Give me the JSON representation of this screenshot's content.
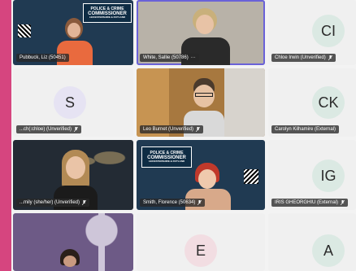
{
  "colors": {
    "accent": "#d6457f",
    "active_speaker": "#6a62d8",
    "avatar_purple": "#e6e3f3",
    "avatar_teal": "#dbe9e3",
    "avatar_pink": "#f2dde2"
  },
  "tiles": [
    {
      "name": "Pubbuck, Liz (50451)",
      "kind": "video"
    },
    {
      "name": "White, Sallie (50786)",
      "kind": "video",
      "extra": "···"
    },
    {
      "name": "Chloe Irwin (Unverified)",
      "kind": "avatar",
      "initials": "CI"
    },
    {
      "name": "...ch(:chloe) (Unverified)",
      "kind": "avatar",
      "initials": "S"
    },
    {
      "name": "Leo Burnet (Unverified)",
      "kind": "video"
    },
    {
      "name": "Carolyn Kilhamire (External)",
      "kind": "avatar",
      "initials": "CK"
    },
    {
      "name": "...mily (she/her) (Unverified)",
      "kind": "video"
    },
    {
      "name": "Smith, Florence (50634)",
      "kind": "video"
    },
    {
      "name": "IRIS GHEORGHIU (External)",
      "kind": "avatar",
      "initials": "IG"
    },
    {
      "name": "",
      "kind": "video"
    },
    {
      "name": "",
      "kind": "avatar",
      "initials": "E"
    },
    {
      "name": "",
      "kind": "avatar",
      "initials": "A"
    }
  ],
  "logo": {
    "line1": "POLICE & CRIME",
    "line2": "COMMISSIONER",
    "line3": "LEICESTERSHIRE & RUTLAND"
  }
}
